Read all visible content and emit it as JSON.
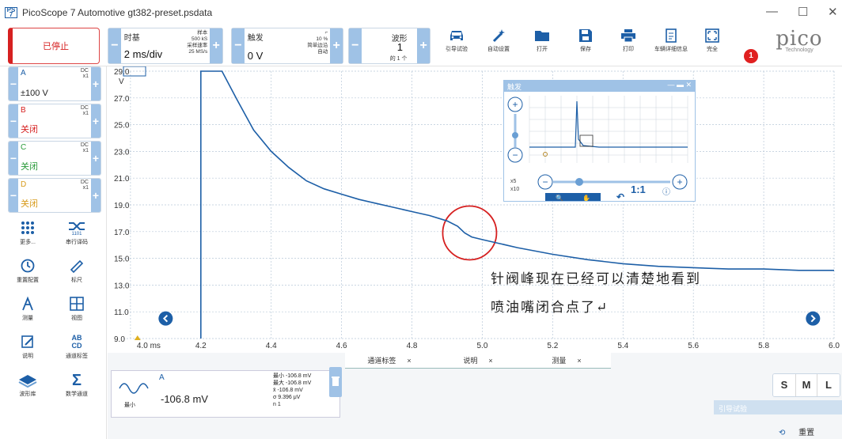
{
  "window": {
    "title": "PicoScope 7 Automotive gt382-preset.psdata",
    "minimize": "—",
    "maximize": "☐",
    "close": "✕"
  },
  "toolbar": {
    "run_state": "已停止",
    "timebase": {
      "label": "时基",
      "value": "2 ms/div",
      "samples_label": "样本",
      "samples": "500 kS",
      "rate_label": "采样速率",
      "rate": "25 MS/s"
    },
    "trigger": {
      "label": "触发",
      "value": "0 V",
      "percent": "10 %",
      "mode": "简单边沿",
      "auto": "自动"
    },
    "waveform": {
      "label": "波形",
      "value": "1",
      "of": "的 1 个"
    },
    "tools": [
      {
        "label": "引导试验",
        "icon": "car-icon"
      },
      {
        "label": "自动设置",
        "icon": "wand-icon"
      },
      {
        "label": "打开",
        "icon": "folder-icon"
      },
      {
        "label": "保存",
        "icon": "save-icon"
      },
      {
        "label": "打印",
        "icon": "print-icon"
      },
      {
        "label": "车辆详细信息",
        "icon": "details-icon"
      },
      {
        "label": "完全",
        "icon": "fullscreen-icon"
      }
    ],
    "notification_count": "1",
    "logo": {
      "text": "pico",
      "sub": "Technology"
    }
  },
  "channels": [
    {
      "name": "A",
      "coupling": "DC",
      "probe": "x1",
      "range": "±100 V",
      "color": "#1d5fa7"
    },
    {
      "name": "B",
      "coupling": "DC",
      "probe": "x1",
      "range": "关闭",
      "color": "#d62020"
    },
    {
      "name": "C",
      "coupling": "DC",
      "probe": "x1",
      "range": "关闭",
      "color": "#2a9a3a"
    },
    {
      "name": "D",
      "coupling": "DC",
      "probe": "x1",
      "range": "关闭",
      "color": "#d79a1a"
    }
  ],
  "side_tools": [
    {
      "label": "更多...",
      "icon": "more-icon"
    },
    {
      "label": "串行译码",
      "icon": "serial-decode-icon"
    },
    {
      "label": "重置配置",
      "icon": "history-icon"
    },
    {
      "label": "标尺",
      "icon": "ruler-icon"
    },
    {
      "label": "测量",
      "icon": "measure-icon"
    },
    {
      "label": "视图",
      "icon": "grid-view-icon"
    },
    {
      "label": "说明",
      "icon": "notes-icon"
    },
    {
      "label": "通道标签",
      "icon": "channel-labels-icon"
    },
    {
      "label": "波形库",
      "icon": "waveform-library-icon"
    },
    {
      "label": "数学通道",
      "icon": "math-icon"
    }
  ],
  "chart_data": {
    "type": "line",
    "xlabel": "",
    "ylabel": "",
    "x_ticks": [
      "4.0 ms",
      "4.2",
      "4.4",
      "4.6",
      "4.8",
      "5.0",
      "5.2",
      "5.4",
      "5.6",
      "5.8",
      "6.0"
    ],
    "y_ticks": [
      "29.0",
      "27.0",
      "25.0",
      "23.0",
      "21.0",
      "19.0",
      "17.0",
      "15.0",
      "13.0",
      "11.0",
      "9.0"
    ],
    "y_unit": "V",
    "xlim": [
      3.98,
      6.0
    ],
    "ylim": [
      9.0,
      29.0
    ],
    "series": [
      {
        "x": [
          4.2,
          4.2,
          4.26,
          4.3,
          4.35,
          4.4,
          4.45,
          4.5,
          4.55,
          4.6,
          4.65,
          4.7,
          4.75,
          4.8,
          4.85,
          4.9,
          4.93,
          4.95,
          4.97,
          5.0,
          5.05,
          5.1,
          5.2,
          5.3,
          5.4,
          5.5,
          5.6,
          5.7,
          5.8,
          5.9,
          6.0
        ],
        "y": [
          9.0,
          29.0,
          29.0,
          27.0,
          24.6,
          23.0,
          21.8,
          20.8,
          20.2,
          19.8,
          19.4,
          19.1,
          18.8,
          18.5,
          18.2,
          17.8,
          17.4,
          16.9,
          16.6,
          16.4,
          16.1,
          15.8,
          15.3,
          14.9,
          14.6,
          14.4,
          14.3,
          14.2,
          14.2,
          14.1,
          14.1
        ],
        "color": "#1d5fa7"
      }
    ]
  },
  "annotation": {
    "line1": "针阀峰现在已经可以清楚地看到",
    "line2": "喷油嘴闭合点了↵"
  },
  "trigger_overlay": {
    "title": "触发",
    "zoom_x5": "x5",
    "zoom_x10": "x10",
    "ratio": "1:1"
  },
  "bottom_tabs": [
    {
      "label": "通道标签",
      "close": "×"
    },
    {
      "label": "说明",
      "close": "×"
    },
    {
      "label": "测量",
      "close": "×"
    }
  ],
  "measurement": {
    "channel": "A",
    "name": "最小",
    "value": "-106.8 mV",
    "stats": [
      {
        "k": "最小",
        "v": "-106.8 mV"
      },
      {
        "k": "最大",
        "v": "-106.8 mV"
      },
      {
        "k": "x̄",
        "v": "-106.8 mV"
      },
      {
        "k": "σ",
        "v": "9.396 μV"
      },
      {
        "k": "n",
        "v": "1"
      }
    ]
  },
  "size_buttons": [
    "S",
    "M",
    "L"
  ],
  "guided_panel": "引导试验",
  "reset_label": "重置"
}
